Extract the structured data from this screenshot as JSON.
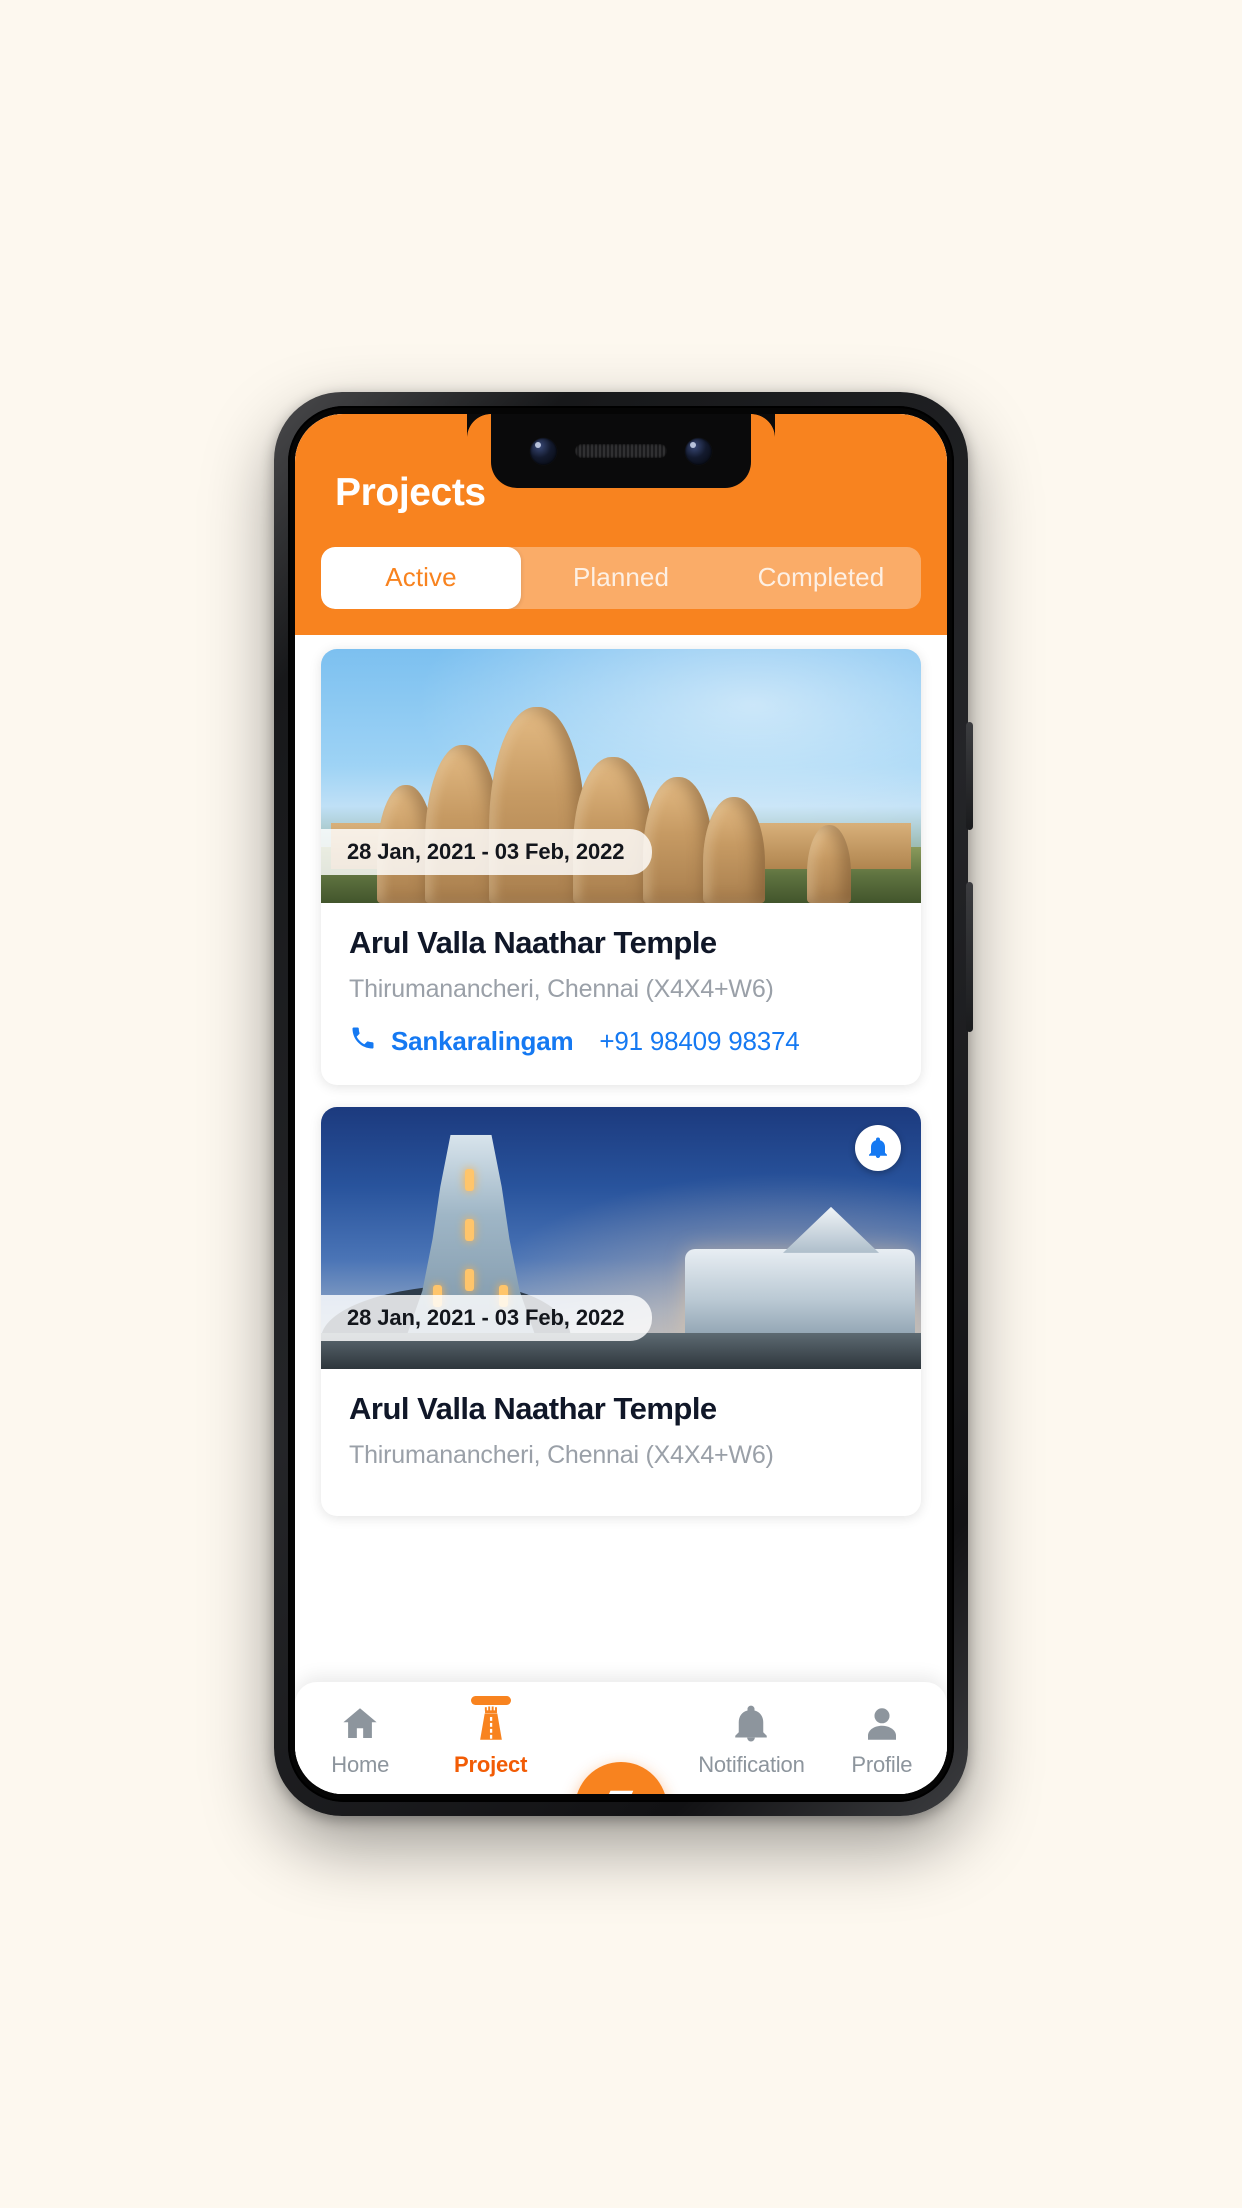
{
  "header": {
    "title": "Projects",
    "accent_color": "#f8831f",
    "tabs": [
      {
        "label": "Active",
        "active": true
      },
      {
        "label": "Planned",
        "active": false
      },
      {
        "label": "Completed",
        "active": false
      }
    ]
  },
  "projects": [
    {
      "date_range": "28 Jan, 2021 - 03 Feb, 2022",
      "title": "Arul Valla Naathar Temple",
      "location": "Thirumanancheri, Chennai (X4X4+W6)",
      "contact_name": "Sankaralingam",
      "contact_phone": "+91 98409 98374",
      "contact_color": "#1579f2",
      "has_bell_badge": false
    },
    {
      "date_range": "28 Jan, 2021 - 03 Feb, 2022",
      "title": "Arul Valla Naathar Temple",
      "location": "Thirumanancheri, Chennai (X4X4+W6)",
      "contact_name": "",
      "contact_phone": "",
      "contact_color": "#1579f2",
      "has_bell_badge": true
    }
  ],
  "bottom_nav": {
    "items": [
      {
        "label": "Home",
        "icon": "home-icon",
        "active": false
      },
      {
        "label": "Project",
        "icon": "temple-icon",
        "active": true
      },
      {
        "label": "Notification",
        "icon": "bell-icon",
        "active": false
      },
      {
        "label": "Profile",
        "icon": "person-icon",
        "active": false
      }
    ],
    "fab": {
      "icon": "rupee-icon",
      "symbol": "₹"
    },
    "active_color": "#f25c05",
    "inactive_color": "#8d959d"
  }
}
